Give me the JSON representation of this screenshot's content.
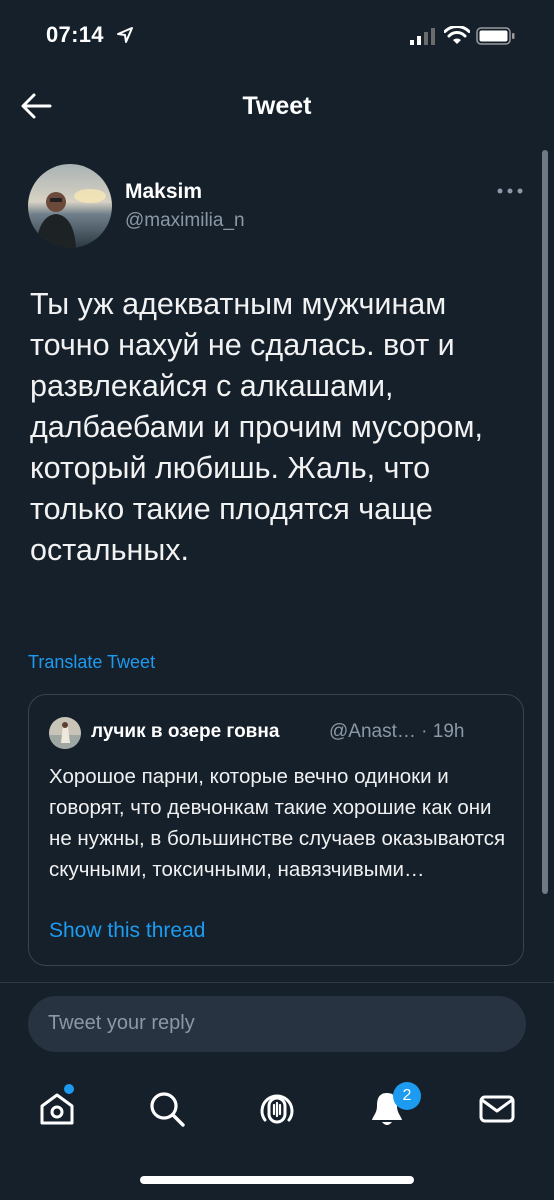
{
  "status": {
    "time": "07:14"
  },
  "header": {
    "title": "Tweet"
  },
  "tweet": {
    "name": "Maksim",
    "handle": "@maximilia_n",
    "text": "Ты уж адекватным мужчинам точно нахуй не сдалась. вот и развлекайся с алкашами, далбаебами и прочим мусором, который любишь. Жаль, что только такие плодятся чаще остальных.",
    "translate_label": "Translate Tweet"
  },
  "quote": {
    "name": "лучик в озере говна",
    "handle_time": "@Anast… · 19h",
    "text": "Хорошое парни, которые вечно одиноки и говорят, что девчонкам такие хорошие как они не нужны, в большинстве случаев оказываются скучными, токсичными, навязчивыми…",
    "link": "Show this thread"
  },
  "reply": {
    "placeholder": "Tweet your reply"
  },
  "tabs": {
    "items": [
      "home-icon",
      "search-icon",
      "spaces-icon",
      "notifications-icon",
      "messages-icon"
    ],
    "notifications_badge": "2"
  },
  "colors": {
    "background": "#15202b",
    "accent": "#1d9bf0",
    "muted": "#8b98a5"
  }
}
